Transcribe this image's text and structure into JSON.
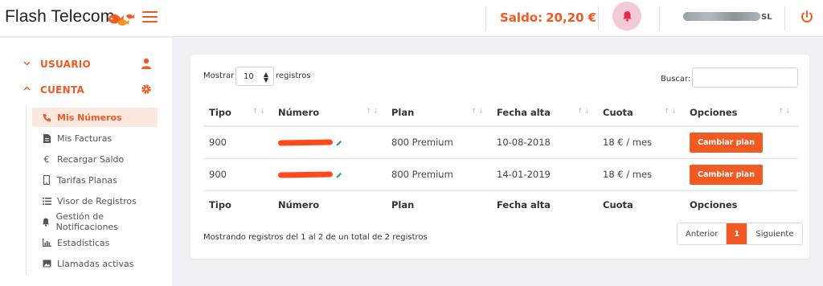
{
  "header": {
    "brand": "Flash Telecom",
    "saldo_label": "Saldo:",
    "saldo_value": "20,20 €",
    "user_suffix": "SL",
    "icons": [
      "fish-logo-icon",
      "menu-icon",
      "bell-icon",
      "power-icon"
    ],
    "accent_color": "#f15a22"
  },
  "sidebar": {
    "sections": [
      {
        "label": "USUARIO",
        "icon": "user-icon",
        "expanded": false
      },
      {
        "label": "CUENTA",
        "icon": "gear-icon",
        "expanded": true
      }
    ],
    "items": [
      {
        "label": "Mis Números",
        "icon": "phone-icon",
        "active": true
      },
      {
        "label": "Mis Facturas",
        "icon": "document-icon"
      },
      {
        "label": "Recargar Saldo",
        "icon": "euro-icon"
      },
      {
        "label": "Tarifas Planas",
        "icon": "mobile-icon"
      },
      {
        "label": "Visor de Registros",
        "icon": "list-icon"
      },
      {
        "label": "Gestión de Notificaciones",
        "icon": "bell-icon"
      },
      {
        "label": "Estadísticas",
        "icon": "chart-icon"
      },
      {
        "label": "Llamadas activas",
        "icon": "image-icon"
      }
    ]
  },
  "table_controls": {
    "show_label": "Mostrar",
    "page_size": "10",
    "records_label": "registros",
    "search_label": "Buscar:",
    "search_value": ""
  },
  "table": {
    "columns": [
      "Tipo",
      "Número",
      "Plan",
      "Fecha alta",
      "Cuota",
      "Opciones"
    ],
    "rows": [
      {
        "tipo": "900",
        "plan": "800 Premium",
        "fecha": "10-08-2018",
        "cuota": "18 € / mes",
        "action": "Cambiar plan"
      },
      {
        "tipo": "900",
        "plan": "800 Premium",
        "fecha": "14-01-2019",
        "cuota": "18 € / mes",
        "action": "Cambiar plan"
      }
    ]
  },
  "footer": {
    "info": "Mostrando registros del 1 al 2 de un total de 2 registros",
    "prev": "Anterior",
    "page": "1",
    "next": "Siguiente"
  }
}
